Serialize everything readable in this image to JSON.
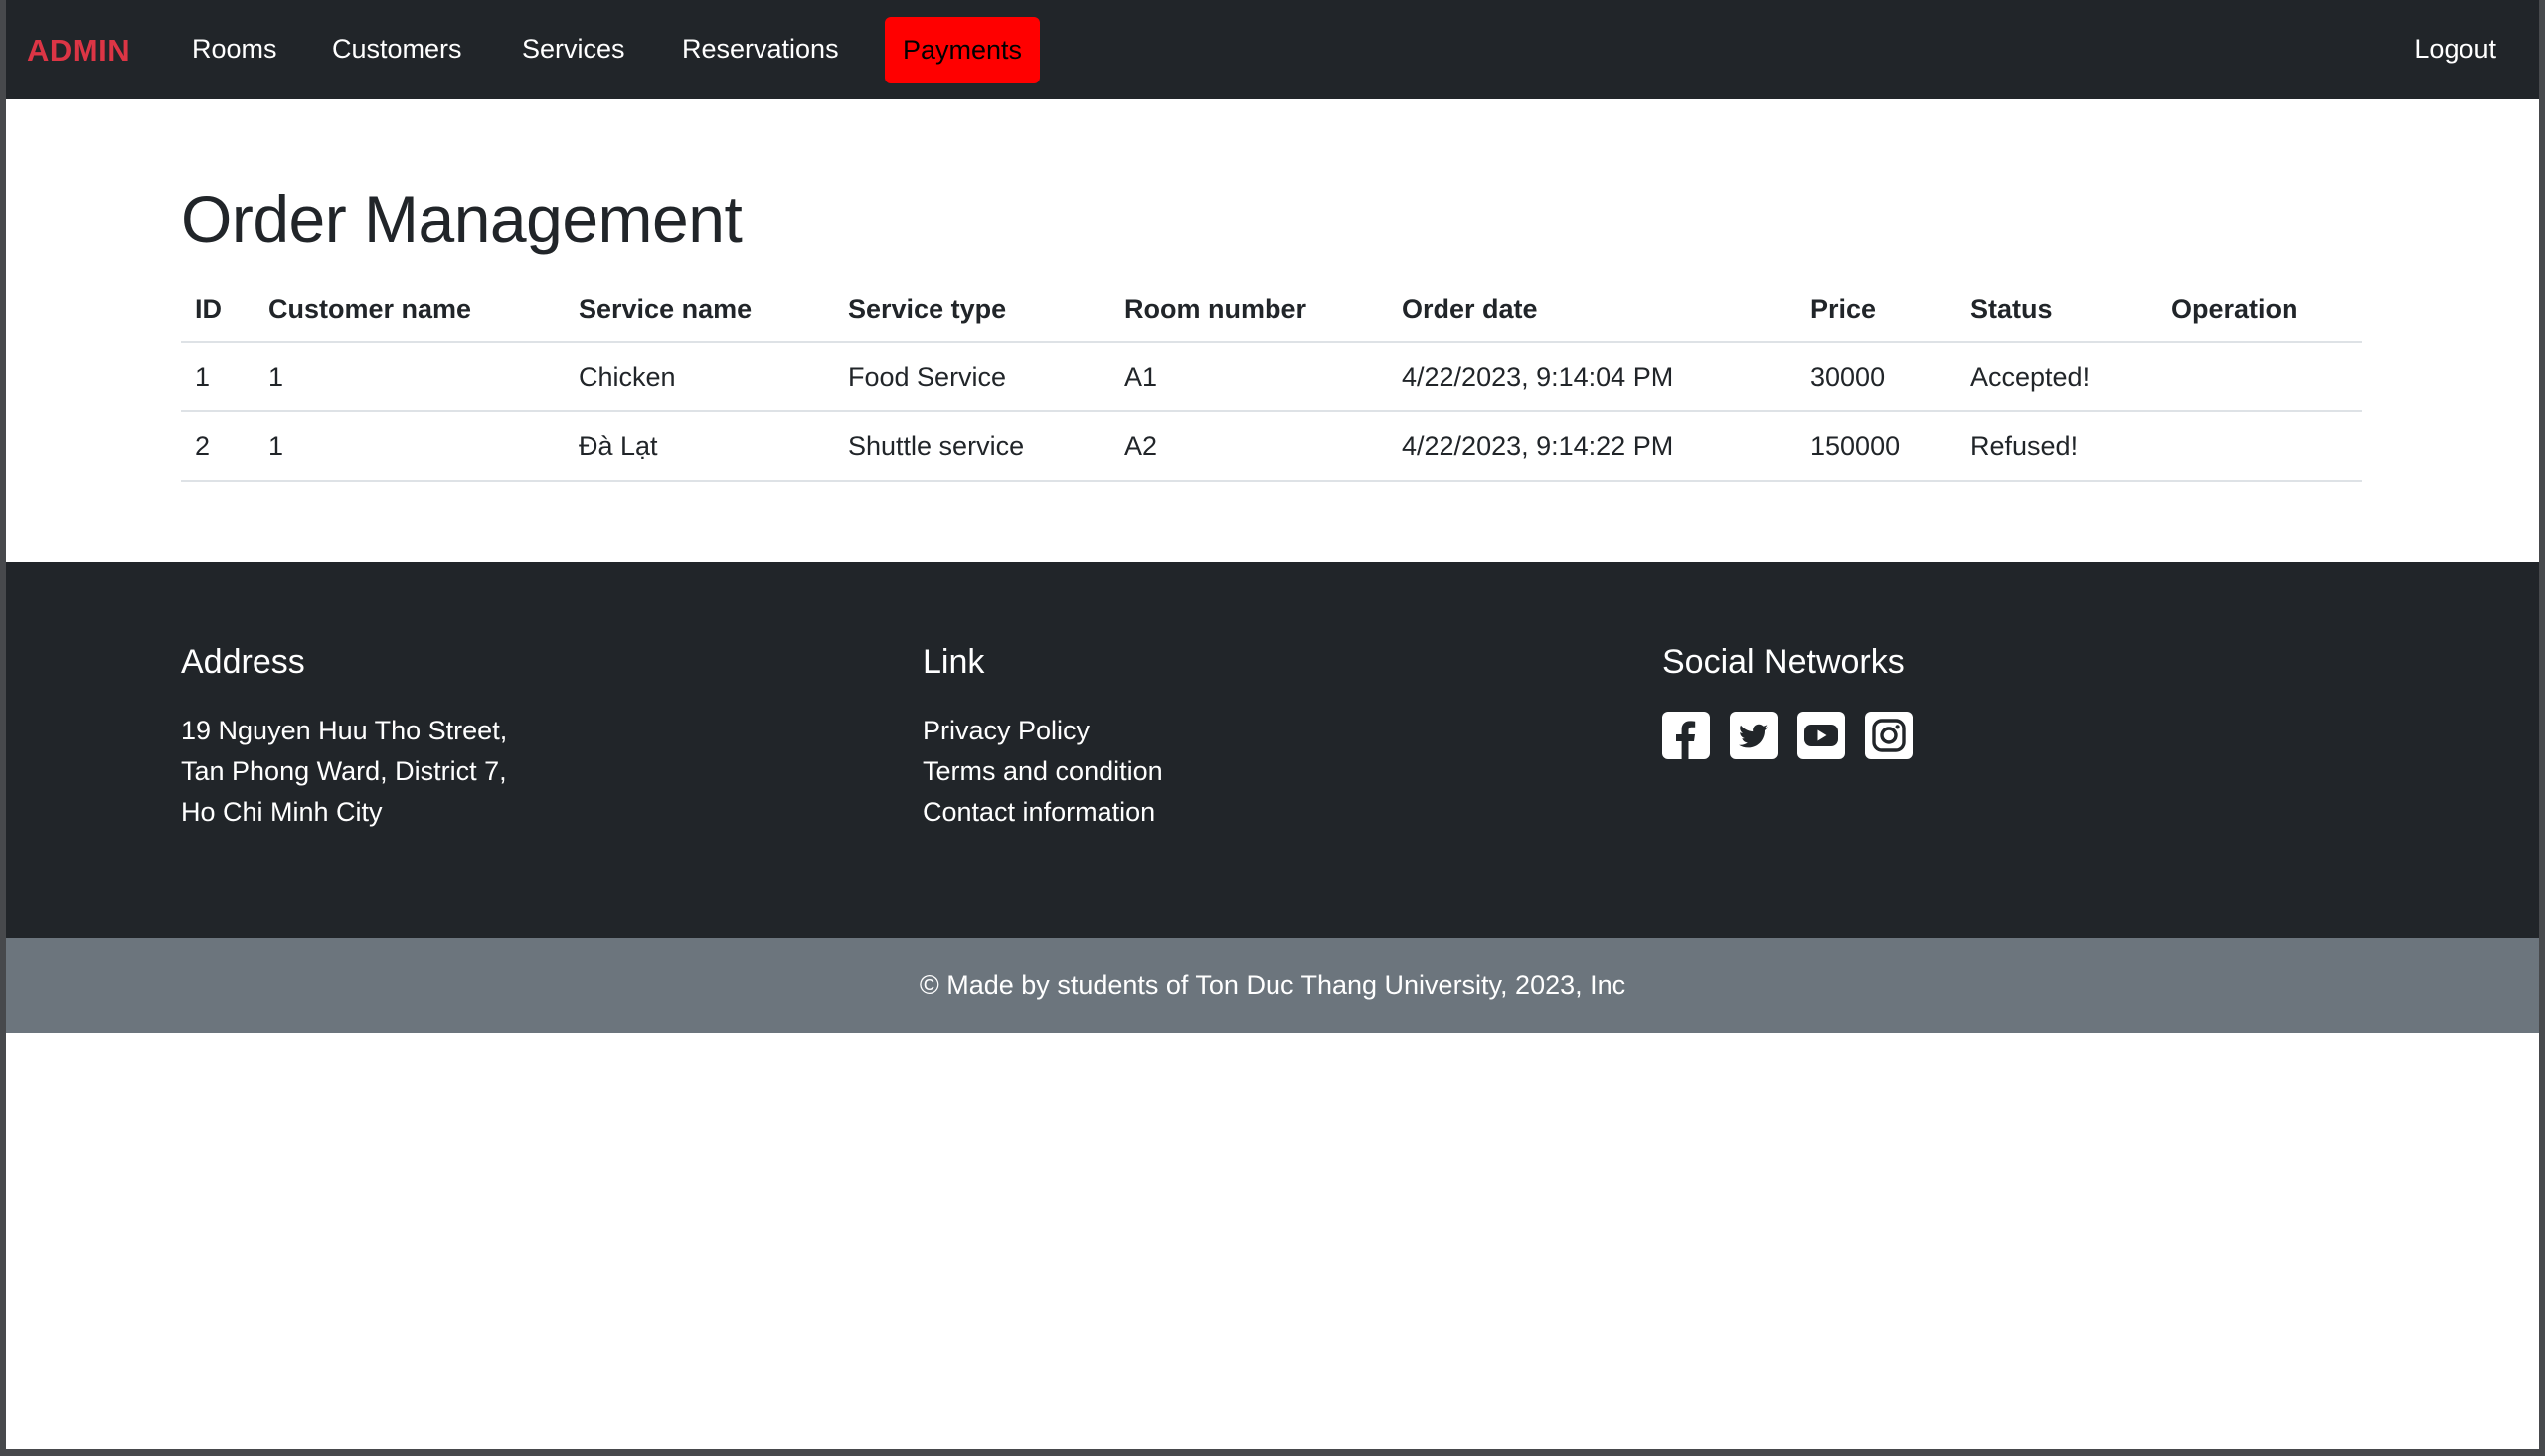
{
  "navbar": {
    "brand": "ADMIN",
    "links": [
      "Rooms",
      "Customers",
      "Services",
      "Reservations"
    ],
    "active": "Payments",
    "logout": "Logout",
    "active_color": "#ff0000",
    "brand_color": "#dc3545"
  },
  "main": {
    "title": "Order Management",
    "columns": [
      "ID",
      "Customer name",
      "Service name",
      "Service type",
      "Room number",
      "Order date",
      "Price",
      "Status",
      "Operation"
    ],
    "rows": [
      [
        "1",
        "1",
        "Chicken",
        "Food Service",
        "A1",
        "4/22/2023, 9:14:04 PM",
        "30000",
        "Accepted!",
        ""
      ],
      [
        "2",
        "1",
        "Đà Lạt",
        "Shuttle service",
        "A2",
        "4/22/2023, 9:14:22 PM",
        "150000",
        "Refused!",
        ""
      ]
    ]
  },
  "footer": {
    "address_title": "Address",
    "address_lines": [
      "19 Nguyen Huu Tho Street,",
      "Tan Phong Ward, District 7,",
      "Ho Chi Minh City"
    ],
    "link_title": "Link",
    "links": [
      "Privacy Policy",
      "Terms and condition",
      "Contact information"
    ],
    "social_title": "Social Networks",
    "social_icons": [
      "facebook-icon",
      "twitter-icon",
      "youtube-icon",
      "instagram-icon"
    ],
    "copyright": "© Made by students of Ton Duc Thang University, 2023, Inc"
  }
}
